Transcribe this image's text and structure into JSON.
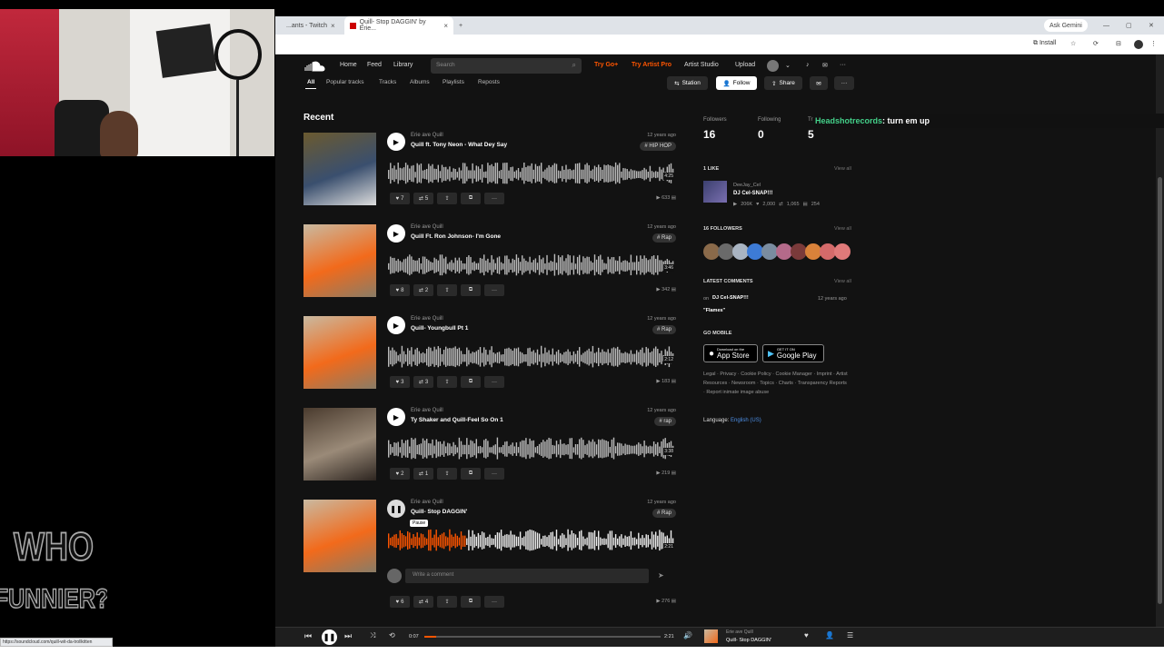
{
  "browser": {
    "tabs": [
      {
        "label": "...ants - Twitch"
      },
      {
        "label": "Quill- Stop DAGGIN' by Erie..."
      }
    ],
    "ask_gemini": "Ask Gemini",
    "install": "Install"
  },
  "sc": {
    "nav": {
      "home": "Home",
      "feed": "Feed",
      "library": "Library",
      "search_placeholder": "Search",
      "try_go": "Try Go+",
      "try_artist": "Try Artist Pro",
      "artist_studio": "Artist Studio",
      "upload": "Upload"
    },
    "subnav": [
      "All",
      "Popular tracks",
      "Tracks",
      "Albums",
      "Playlists",
      "Reposts"
    ],
    "buttons": {
      "station": "Station",
      "follow": "Follow",
      "share": "Share"
    },
    "recent": "Recent",
    "tracks": [
      {
        "artist": "Erie ave Quill",
        "title": "Quill ft. Tony Neon - What Dey Say",
        "date": "12 years ago",
        "tag": "# HIP HOP",
        "likes": "7",
        "reposts": "5",
        "plays": "633",
        "duration": "4:25",
        "colors": [
          "#6b5a2f",
          "#3a4f6e",
          "#ddd"
        ]
      },
      {
        "artist": "Erie ave Quill",
        "title": "Quill Ft. Ron Johnson- I'm Gone",
        "date": "12 years ago",
        "tag": "# Rap",
        "likes": "8",
        "reposts": "2",
        "plays": "342",
        "duration": "3:46",
        "colors": [
          "#c9b9a0",
          "#f26a1b",
          "#8a7c66"
        ]
      },
      {
        "artist": "Erie ave Quill",
        "title": "Quill- Youngbull Pt 1",
        "date": "12 years ago",
        "tag": "# Rap",
        "likes": "3",
        "reposts": "3",
        "plays": "183",
        "duration": "2:12",
        "colors": [
          "#c9b9a0",
          "#f26a1b",
          "#8a7c66"
        ]
      },
      {
        "artist": "Erie ave Quill",
        "title": "Ty Shaker and Quill-Feel So On 1",
        "date": "12 years ago",
        "tag": "# rap",
        "likes": "2",
        "reposts": "1",
        "plays": "219",
        "duration": "3:38",
        "colors": [
          "#4a3b2e",
          "#9a8a78",
          "#2d2520"
        ]
      },
      {
        "artist": "Erie ave Quill",
        "title": "Quill- Stop DAGGIN'",
        "date": "12 years ago",
        "tag": "# Rap",
        "likes": "6",
        "reposts": "4",
        "plays": "276",
        "duration": "2:21",
        "colors": [
          "#c9b9a0",
          "#f26a1b",
          "#8a7c66"
        ],
        "playing": true,
        "progress": 0.27,
        "pause_tooltip": "Pause",
        "comment_placeholder": "Write a comment"
      }
    ],
    "stats": [
      {
        "label": "Followers",
        "value": "16"
      },
      {
        "label": "Following",
        "value": "0"
      },
      {
        "label": "Tr",
        "value": "5"
      }
    ],
    "likes_header": "1 LIKE",
    "view_all": "View all",
    "liked": {
      "user": "DeeJay_Cel",
      "title": "DJ Cel-SNAP!!!",
      "plays": "206K",
      "likes": "2,000",
      "reposts": "1,065",
      "comments": "254"
    },
    "followers_header": "16 FOLLOWERS",
    "comments_header": "LATEST COMMENTS",
    "comment": {
      "on": "on",
      "track": "DJ Cel-SNAP!!!",
      "date": "12 years ago",
      "text": "\"Flames\""
    },
    "mobile_header": "GO MOBILE",
    "app_store": "App Store",
    "app_store_small": "Download on the",
    "google_play": "Google Play",
    "google_play_small": "GET IT ON",
    "footer_links": "Legal · Privacy · Cookie Policy · Cookie Manager · Imprint · Artist Resources · Newsroom · Topics · Charts · Transparency Reports · Report inimate image abuse",
    "language_label": "Language:",
    "language_value": "English (US)"
  },
  "chat": {
    "user": "Headshotrecords",
    "message": ": turn em up"
  },
  "overlay_logo": "WHO FUNNIER?",
  "player": {
    "elapsed": "0:07",
    "total": "2:21",
    "artist": "Erie ave Quill",
    "title": "Quill- Stop DAGGIN'",
    "progress": 0.05
  },
  "status_url": "https://soundcloud.com/quill-wit-da-trollkitten"
}
